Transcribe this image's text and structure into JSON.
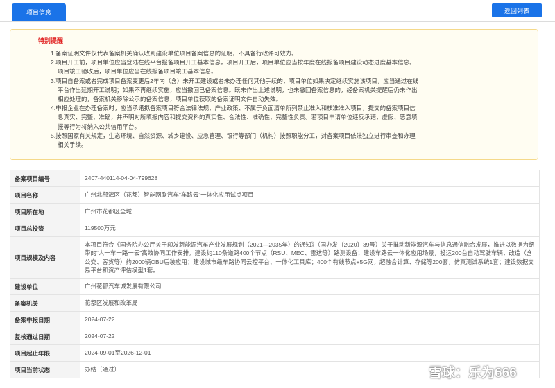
{
  "tabs": {
    "active_label": "项目信息"
  },
  "actions": {
    "back_label": "返回列表"
  },
  "notice": {
    "title": "特别提醒",
    "lines": [
      "1.备案证明文件仅代表备案机关确认收到建设单位项目备案信息的证明，不具备行政许可效力。",
      "2.项目开工前，项目单位应当登陆在线平台报备项目开工基本信息。项目开工后，项目单位应当按年度在线报备项目建设动态进度基本信息。",
      "项目竣工验收后，项目单位应当在线报备项目竣工基本信息。",
      "3.项目自备案或者完成项目备案变更后2年内（含）未开工建设或者未办理任何其他手续的，项目单位如果决定继续实施该项目，应当通过在线",
      "平台作出延期开工说明；如果不再继续实施，应当撤回已备案信息。既未作出上述说明，也未撤回备案信息的，经备案机关提醒后仍未作出",
      "相应处理的，备案机关移除公示的备案信息，项目单位获取的备案证明文件自动失效。",
      "4.申报企业在办理备案时，应当承诺拟备案项目符合法律法规、产业政策、不属于负面清单所列禁止准入和核准准入项目，提交的备案项目信",
      "息真实、完整、准确，并声明对所填报内容和提交资料的真实性、合法性、准确性、完整性负责。若项目申请单位违反承诺，虚假、恶意填",
      "报等行为将纳入公共信用平台。",
      "5.按照国家有关规定，生态环境、自然资源、城乡建设、应急管理、银行等部门（机构）按照职能分工，对备案项目依法独立进行审查和办理",
      "相关手续。"
    ]
  },
  "project": {
    "rows": [
      {
        "label": "备案项目编号",
        "value": "2407-440114-04-04-799628"
      },
      {
        "label": "项目名称",
        "value": "广州北部湾区（花都）智能网联汽车“车路云”一体化应用试点项目"
      },
      {
        "label": "项目所在地",
        "value": "广州市花都区全域"
      },
      {
        "label": "项目总投资",
        "value": "119500万元"
      },
      {
        "label": "项目规模及内容",
        "value": "本项目符合《国务院办公厅关于印发新能源汽车产业发展规划（2021—2035年）的通知》（国办发〔2020〕39号）关于推动新能源汽车与信息通信融合发展，推进以数据为纽带的“人一车一路一云”高效协同工作安排。建设约110条道路400个节点（RSU、MEC、雷达等）路测设备；建设车路云一体化应用场景，投运200台自动驾驶车辆，改造（含公交、客货等）约2000辆OBU后装应用；建设城市级车路协同云控平台、一体化工具库；400个有线节点+5G网，超融合计算、存储等200套，仿真测试系统1套；建设数据交易平台和资产评估模型1套。"
      },
      {
        "label": "建设单位",
        "value": "广州花都汽车城发展有限公司"
      },
      {
        "label": "备案机关",
        "value": "花都区发展和改革局"
      },
      {
        "label": "备案申报日期",
        "value": "2024-07-22"
      },
      {
        "label": "复核通过日期",
        "value": "2024-07-22"
      },
      {
        "label": "项目起止年限",
        "value": "2024-09-01至2026-12-01"
      },
      {
        "label": "项目当前状态",
        "value": "办结（通过）"
      }
    ]
  },
  "watermark": {
    "text": "雪球：乐为666",
    "icon": "snowball-logo-icon"
  },
  "colors": {
    "accent": "#1a73e8",
    "notice_title": "#e02020",
    "notice_border": "#f5d98a"
  }
}
